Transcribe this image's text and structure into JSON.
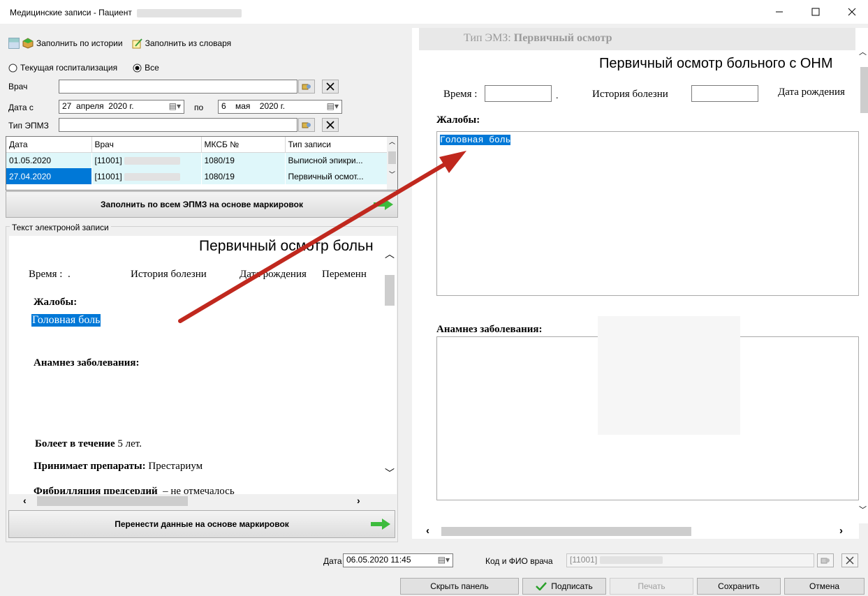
{
  "window": {
    "title": "Медицинские записи - Пациент"
  },
  "toolbar": {
    "fill_history": "Заполнить по истории",
    "fill_dictionary": "Заполнить из словаря"
  },
  "filters": {
    "radio_current": "Текущая госпитализация",
    "radio_all": "Все",
    "doctor_label": "Врач",
    "date_from_label": "Дата с",
    "date_from": "27  апреля  2020 г.",
    "to_label": "по",
    "date_to": "6    мая    2020 г.",
    "type_label": "Тип ЭПМЗ"
  },
  "grid": {
    "columns": [
      "Дата",
      "Врач",
      "МКСБ №",
      "Тип записи"
    ],
    "rows": [
      {
        "date": "01.05.2020",
        "doctor": "[11001]",
        "mksb": "1080/19",
        "type": "Выписной эпикри..."
      },
      {
        "date": "27.04.2020",
        "doctor": "[11001]",
        "mksb": "1080/19",
        "type": "Первичный осмот..."
      }
    ]
  },
  "buttons": {
    "fill_all": "Заполнить по всем ЭПМЗ на основе маркировок",
    "transfer": "Перенести данные на основе маркировок",
    "hide_panel": "Скрыть панель",
    "sign": "Подписать",
    "print": "Печать",
    "save": "Сохранить",
    "cancel": "Отмена"
  },
  "left_doc": {
    "group_label": "Текст электроной записи",
    "heading": "Первичный осмотр больн",
    "time_label": "Время :  .",
    "history_label": "История болезни",
    "birth_label": "Дата рождения",
    "variable_label": "Переменн",
    "complaints_label": "Жалобы:",
    "complaints_value": "Головная боль",
    "anamnesis_label": "Анамнез заболевания:",
    "ill_label": "Болеет в течение",
    "ill_value": "5",
    "ill_unit": "лет.",
    "drugs_label": "Принимает препараты:",
    "drugs_value": "Престариум",
    "fibr_label": "Фибрилляция предсердий",
    "fibr_value": "не отмечалось"
  },
  "right_doc": {
    "type_header_label": "Тип ЭМЗ:",
    "type_header_value": "Первичный осмотр",
    "heading": "Первичный осмотр больного с ОНМ",
    "time_label": "Время :",
    "dot": ".",
    "history_label": "История болезни",
    "birth_label": "Дата рождения",
    "complaints_label": "Жалобы:",
    "complaints_value": "Головная боль",
    "anamnesis_label": "Анамнез заболевания:"
  },
  "bottom": {
    "date_label": "Дата",
    "date_value": "06.05.2020 11:45",
    "doctor_label": "Код и ФИО врача",
    "doctor_value": "[11001]"
  },
  "colors": {
    "accent": "#0078d7",
    "arrow": "#c0281e",
    "row_bg": "#dff7fa",
    "green": "#3dbb3d"
  }
}
